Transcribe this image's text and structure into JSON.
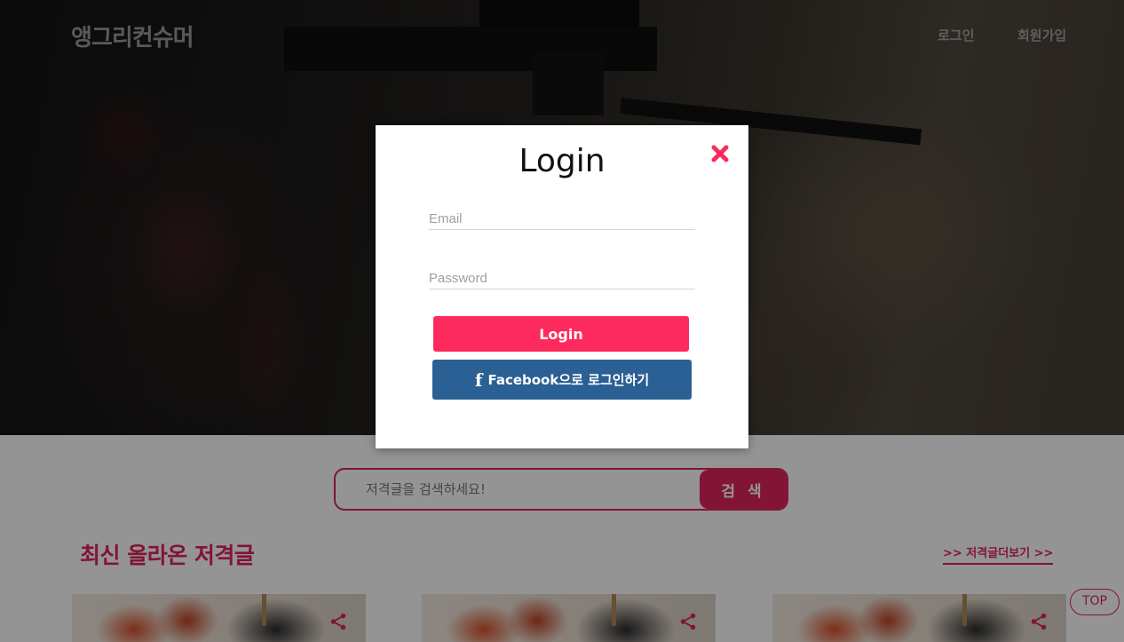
{
  "header": {
    "logo": "앵그리컨슈머",
    "nav": {
      "login": "로그인",
      "signup": "회원가입"
    }
  },
  "search": {
    "placeholder": "저격글을 검색하세요!",
    "button_label": "검 색"
  },
  "section": {
    "title": "최신 올라온 저격글",
    "more_label": ">> 저격글더보기 >>"
  },
  "cards": [
    {
      "share_icon": "share-icon"
    },
    {
      "share_icon": "share-icon"
    },
    {
      "share_icon": "share-icon"
    }
  ],
  "top_button": "TOP",
  "modal": {
    "title": "Login",
    "email_placeholder": "Email",
    "password_placeholder": "Password",
    "login_button": "Login",
    "facebook_icon": "f",
    "facebook_button": "Facebook으로 로그인하기",
    "close_icon": "close-icon"
  },
  "colors": {
    "accent": "#e0245e",
    "login_button": "#fd2b5d",
    "facebook_button": "#2a6094"
  }
}
